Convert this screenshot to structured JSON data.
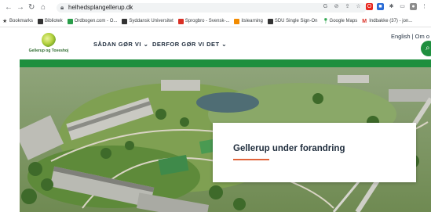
{
  "browser": {
    "url": "helhedsplangellerup.dk",
    "bookmarks": [
      {
        "label": "Bookmarks",
        "color": "#444444"
      },
      {
        "label": "Bibliotek",
        "color": "#333333"
      },
      {
        "label": "Ordbogen.com - O...",
        "color": "#2a9d4a"
      },
      {
        "label": "Syddansk Universitet",
        "color": "#333333"
      },
      {
        "label": "Sprogbro - Svensk-...",
        "color": "#d93025"
      },
      {
        "label": "itslearning",
        "color": "#f28b00"
      },
      {
        "label": "SDU Single Sign-On",
        "color": "#333333"
      },
      {
        "label": "Google Maps",
        "color": "#34a853"
      },
      {
        "label": "Indbakke (37) - jon...",
        "color": "#d93025"
      }
    ]
  },
  "site": {
    "logo_text": "Gellerup og Toveshoj",
    "nav": [
      {
        "label": "SÅDAN GØR VI"
      },
      {
        "label": "DERFOR GØR VI DET"
      }
    ],
    "language": "English | Om o",
    "accent_color": "#1e8f3e"
  },
  "hero": {
    "title": "Gellerup under forandring",
    "underline_color": "#e0633a"
  }
}
